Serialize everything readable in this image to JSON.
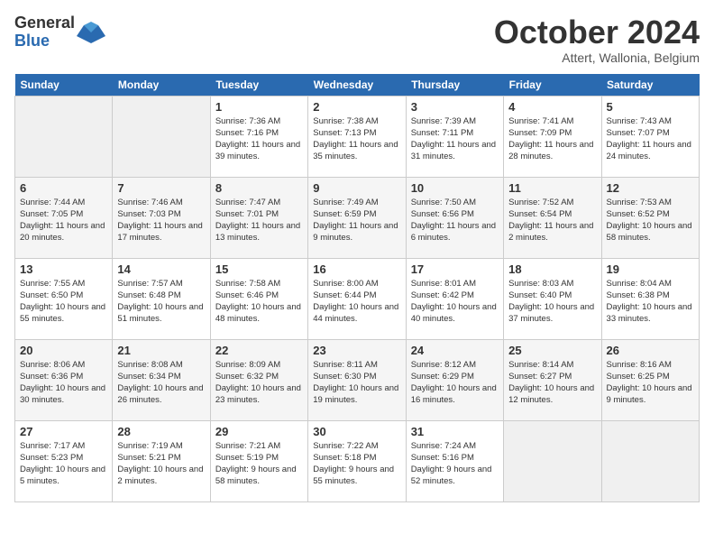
{
  "logo": {
    "general": "General",
    "blue": "Blue"
  },
  "title": "October 2024",
  "location": "Attert, Wallonia, Belgium",
  "days_of_week": [
    "Sunday",
    "Monday",
    "Tuesday",
    "Wednesday",
    "Thursday",
    "Friday",
    "Saturday"
  ],
  "weeks": [
    [
      {
        "day": "",
        "sunrise": "",
        "sunset": "",
        "daylight": ""
      },
      {
        "day": "",
        "sunrise": "",
        "sunset": "",
        "daylight": ""
      },
      {
        "day": "1",
        "sunrise": "Sunrise: 7:36 AM",
        "sunset": "Sunset: 7:16 PM",
        "daylight": "Daylight: 11 hours and 39 minutes."
      },
      {
        "day": "2",
        "sunrise": "Sunrise: 7:38 AM",
        "sunset": "Sunset: 7:13 PM",
        "daylight": "Daylight: 11 hours and 35 minutes."
      },
      {
        "day": "3",
        "sunrise": "Sunrise: 7:39 AM",
        "sunset": "Sunset: 7:11 PM",
        "daylight": "Daylight: 11 hours and 31 minutes."
      },
      {
        "day": "4",
        "sunrise": "Sunrise: 7:41 AM",
        "sunset": "Sunset: 7:09 PM",
        "daylight": "Daylight: 11 hours and 28 minutes."
      },
      {
        "day": "5",
        "sunrise": "Sunrise: 7:43 AM",
        "sunset": "Sunset: 7:07 PM",
        "daylight": "Daylight: 11 hours and 24 minutes."
      }
    ],
    [
      {
        "day": "6",
        "sunrise": "Sunrise: 7:44 AM",
        "sunset": "Sunset: 7:05 PM",
        "daylight": "Daylight: 11 hours and 20 minutes."
      },
      {
        "day": "7",
        "sunrise": "Sunrise: 7:46 AM",
        "sunset": "Sunset: 7:03 PM",
        "daylight": "Daylight: 11 hours and 17 minutes."
      },
      {
        "day": "8",
        "sunrise": "Sunrise: 7:47 AM",
        "sunset": "Sunset: 7:01 PM",
        "daylight": "Daylight: 11 hours and 13 minutes."
      },
      {
        "day": "9",
        "sunrise": "Sunrise: 7:49 AM",
        "sunset": "Sunset: 6:59 PM",
        "daylight": "Daylight: 11 hours and 9 minutes."
      },
      {
        "day": "10",
        "sunrise": "Sunrise: 7:50 AM",
        "sunset": "Sunset: 6:56 PM",
        "daylight": "Daylight: 11 hours and 6 minutes."
      },
      {
        "day": "11",
        "sunrise": "Sunrise: 7:52 AM",
        "sunset": "Sunset: 6:54 PM",
        "daylight": "Daylight: 11 hours and 2 minutes."
      },
      {
        "day": "12",
        "sunrise": "Sunrise: 7:53 AM",
        "sunset": "Sunset: 6:52 PM",
        "daylight": "Daylight: 10 hours and 58 minutes."
      }
    ],
    [
      {
        "day": "13",
        "sunrise": "Sunrise: 7:55 AM",
        "sunset": "Sunset: 6:50 PM",
        "daylight": "Daylight: 10 hours and 55 minutes."
      },
      {
        "day": "14",
        "sunrise": "Sunrise: 7:57 AM",
        "sunset": "Sunset: 6:48 PM",
        "daylight": "Daylight: 10 hours and 51 minutes."
      },
      {
        "day": "15",
        "sunrise": "Sunrise: 7:58 AM",
        "sunset": "Sunset: 6:46 PM",
        "daylight": "Daylight: 10 hours and 48 minutes."
      },
      {
        "day": "16",
        "sunrise": "Sunrise: 8:00 AM",
        "sunset": "Sunset: 6:44 PM",
        "daylight": "Daylight: 10 hours and 44 minutes."
      },
      {
        "day": "17",
        "sunrise": "Sunrise: 8:01 AM",
        "sunset": "Sunset: 6:42 PM",
        "daylight": "Daylight: 10 hours and 40 minutes."
      },
      {
        "day": "18",
        "sunrise": "Sunrise: 8:03 AM",
        "sunset": "Sunset: 6:40 PM",
        "daylight": "Daylight: 10 hours and 37 minutes."
      },
      {
        "day": "19",
        "sunrise": "Sunrise: 8:04 AM",
        "sunset": "Sunset: 6:38 PM",
        "daylight": "Daylight: 10 hours and 33 minutes."
      }
    ],
    [
      {
        "day": "20",
        "sunrise": "Sunrise: 8:06 AM",
        "sunset": "Sunset: 6:36 PM",
        "daylight": "Daylight: 10 hours and 30 minutes."
      },
      {
        "day": "21",
        "sunrise": "Sunrise: 8:08 AM",
        "sunset": "Sunset: 6:34 PM",
        "daylight": "Daylight: 10 hours and 26 minutes."
      },
      {
        "day": "22",
        "sunrise": "Sunrise: 8:09 AM",
        "sunset": "Sunset: 6:32 PM",
        "daylight": "Daylight: 10 hours and 23 minutes."
      },
      {
        "day": "23",
        "sunrise": "Sunrise: 8:11 AM",
        "sunset": "Sunset: 6:30 PM",
        "daylight": "Daylight: 10 hours and 19 minutes."
      },
      {
        "day": "24",
        "sunrise": "Sunrise: 8:12 AM",
        "sunset": "Sunset: 6:29 PM",
        "daylight": "Daylight: 10 hours and 16 minutes."
      },
      {
        "day": "25",
        "sunrise": "Sunrise: 8:14 AM",
        "sunset": "Sunset: 6:27 PM",
        "daylight": "Daylight: 10 hours and 12 minutes."
      },
      {
        "day": "26",
        "sunrise": "Sunrise: 8:16 AM",
        "sunset": "Sunset: 6:25 PM",
        "daylight": "Daylight: 10 hours and 9 minutes."
      }
    ],
    [
      {
        "day": "27",
        "sunrise": "Sunrise: 7:17 AM",
        "sunset": "Sunset: 5:23 PM",
        "daylight": "Daylight: 10 hours and 5 minutes."
      },
      {
        "day": "28",
        "sunrise": "Sunrise: 7:19 AM",
        "sunset": "Sunset: 5:21 PM",
        "daylight": "Daylight: 10 hours and 2 minutes."
      },
      {
        "day": "29",
        "sunrise": "Sunrise: 7:21 AM",
        "sunset": "Sunset: 5:19 PM",
        "daylight": "Daylight: 9 hours and 58 minutes."
      },
      {
        "day": "30",
        "sunrise": "Sunrise: 7:22 AM",
        "sunset": "Sunset: 5:18 PM",
        "daylight": "Daylight: 9 hours and 55 minutes."
      },
      {
        "day": "31",
        "sunrise": "Sunrise: 7:24 AM",
        "sunset": "Sunset: 5:16 PM",
        "daylight": "Daylight: 9 hours and 52 minutes."
      },
      {
        "day": "",
        "sunrise": "",
        "sunset": "",
        "daylight": ""
      },
      {
        "day": "",
        "sunrise": "",
        "sunset": "",
        "daylight": ""
      }
    ]
  ]
}
